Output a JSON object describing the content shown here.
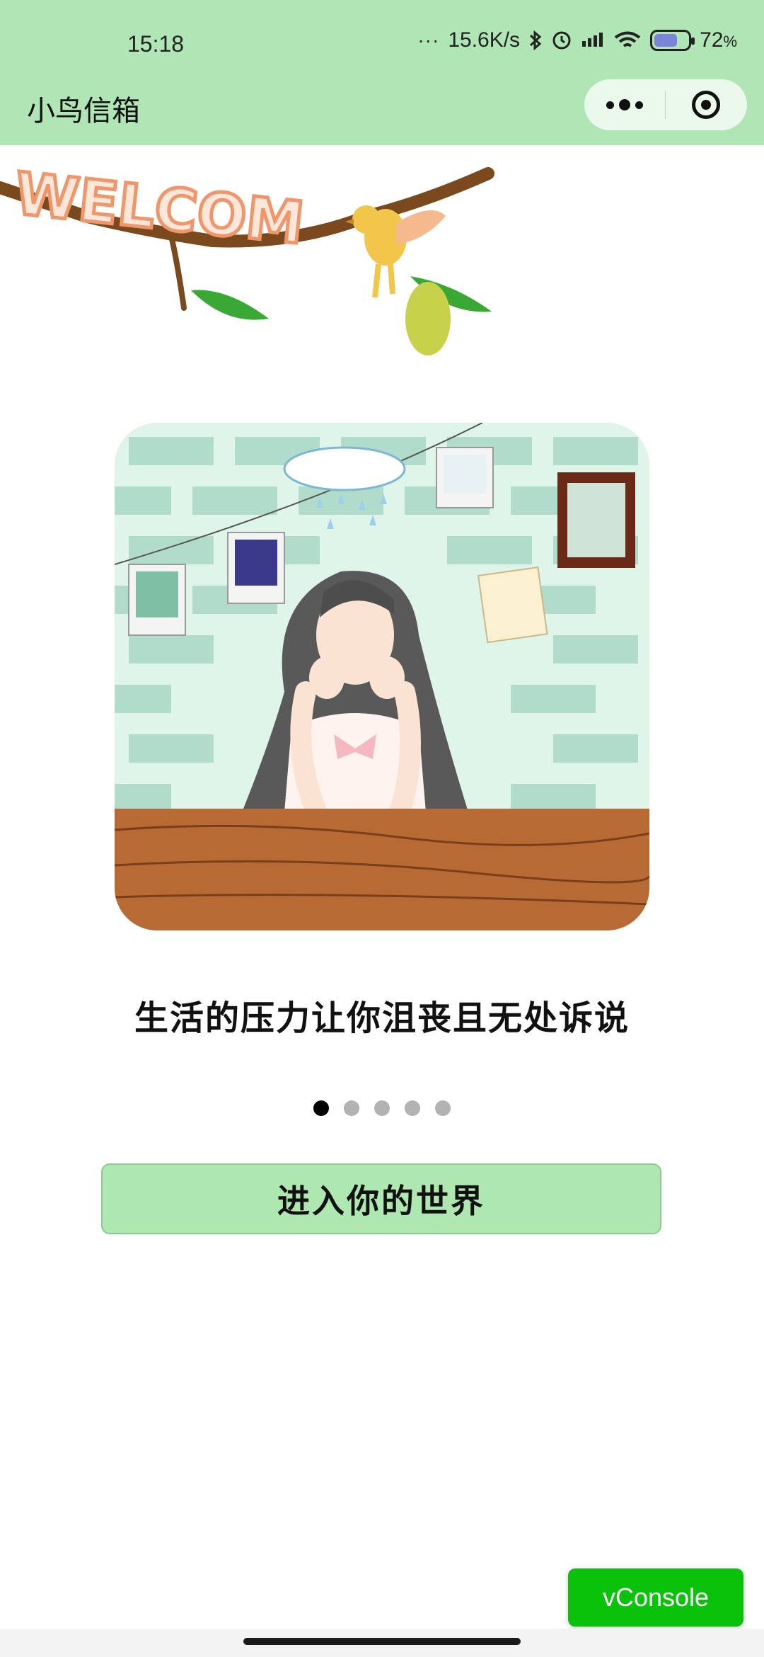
{
  "status_bar": {
    "time": "15:18",
    "more": "···",
    "net_speed": "15.6K/s",
    "battery": "72",
    "battery_unit": "%"
  },
  "nav": {
    "title": "小鸟信箱"
  },
  "banner": {
    "text": "WELCOM"
  },
  "slide": {
    "caption": "生活的压力让你沮丧且无处诉说",
    "current_index": 0,
    "total": 5
  },
  "enter_button": {
    "label": "进入你的世界"
  },
  "vconsole": {
    "label": "vConsole"
  },
  "colors": {
    "header": "#b0e6b5",
    "button": "#aee8b0",
    "vconsole": "#0bc20b"
  }
}
